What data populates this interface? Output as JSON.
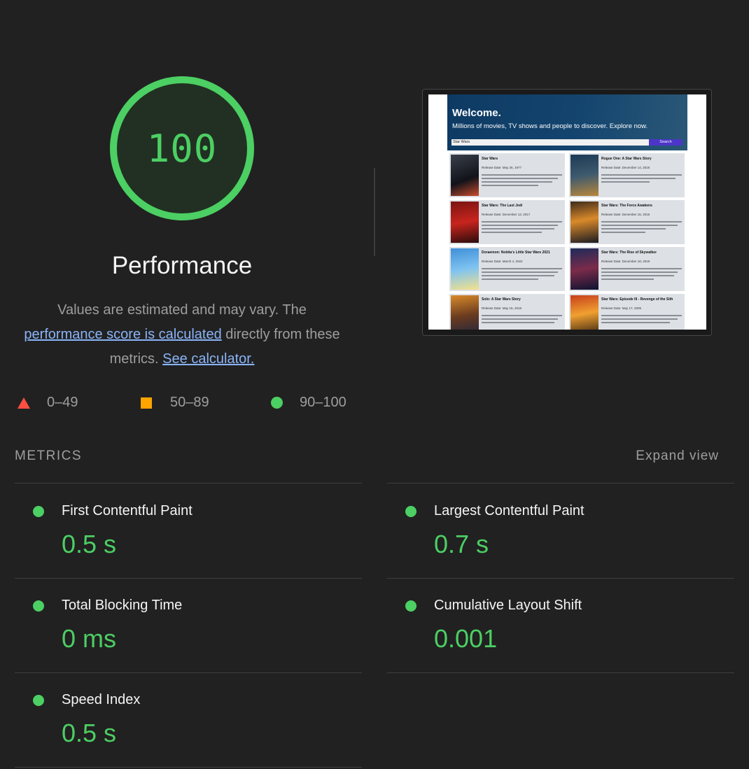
{
  "score": {
    "value": "100",
    "fraction": 1.0,
    "title": "Performance",
    "color": "#4ccf63"
  },
  "description": {
    "part1": "Values are estimated and may vary. The ",
    "link1": "performance score is calculated",
    "part2": " directly from these metrics. ",
    "link2": "See calculator."
  },
  "legend": [
    {
      "icon": "triangle-icon",
      "label": "0–49",
      "color": "#ff4e42"
    },
    {
      "icon": "square-icon",
      "label": "50–89",
      "color": "#ffa400"
    },
    {
      "icon": "circle-icon",
      "label": "90–100",
      "color": "#4ccf63"
    }
  ],
  "screenshot": {
    "welcome": "Welcome.",
    "subtitle": "Millions of movies, TV shows and people to discover. Explore now.",
    "search_value": "Star Wars",
    "search_button": "Search",
    "cards": [
      {
        "title": "Star Wars",
        "date": "Release Date: May 25, 1977"
      },
      {
        "title": "Rogue One: A Star Wars Story",
        "date": "Release Date: December 14, 2016"
      },
      {
        "title": "Star Wars: The Last Jedi",
        "date": "Release Date: December 13, 2017"
      },
      {
        "title": "Star Wars: The Force Awakens",
        "date": "Release Date: December 15, 2015"
      },
      {
        "title": "Doraemon: Nobita's Little Star Wars 2021",
        "date": "Release Date: March 4, 2022"
      },
      {
        "title": "Star Wars: The Rise of Skywalker",
        "date": "Release Date: December 18, 2019"
      },
      {
        "title": "Solo: A Star Wars Story",
        "date": "Release Date: May 15, 2018"
      },
      {
        "title": "Star Wars: Episode III - Revenge of the Sith",
        "date": "Release Date: May 17, 2005"
      }
    ]
  },
  "metrics": {
    "heading": "METRICS",
    "expand_label": "Expand view",
    "items": [
      {
        "label": "First Contentful Paint",
        "value": "0.5 s"
      },
      {
        "label": "Largest Contentful Paint",
        "value": "0.7 s"
      },
      {
        "label": "Total Blocking Time",
        "value": "0 ms"
      },
      {
        "label": "Cumulative Layout Shift",
        "value": "0.001"
      },
      {
        "label": "Speed Index",
        "value": "0.5 s"
      }
    ]
  }
}
